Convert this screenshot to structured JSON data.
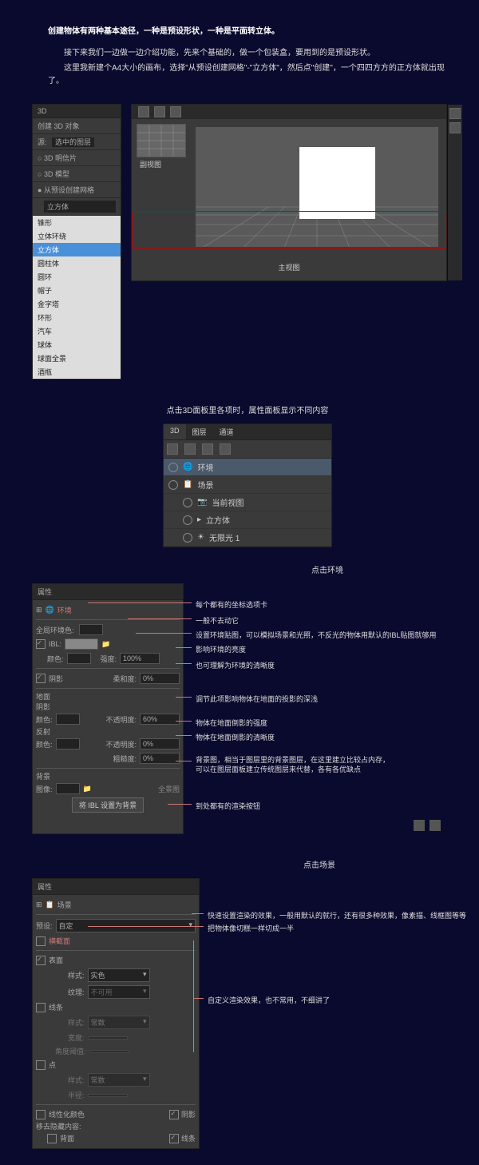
{
  "article": {
    "title": "创建物体有两种基本途径，一种是预设形状，一种是平面转立体。",
    "para1": "接下来我们一边做一边介绍功能，先来个基础的，做一个包装盒，要用到的是预设形状。",
    "para2": "这里我新建个A4大小的画布，选择\"从预设创建网格\"-\"立方体\"，然后点\"创建\"，一个四四方方的正方体就出现了。"
  },
  "leftpanel": {
    "header": "3D",
    "create_btn": "创建 3D 对象",
    "source_label": "源:",
    "source_value": "选中的图层",
    "opt_3d_postcard": "3D 明信片",
    "opt_3d_model": "3D 模型",
    "opt_preset_mesh": "从预设创建网格",
    "sel_cube": "立方体",
    "items": [
      "锥形",
      "立体环绕",
      "立方体",
      "圆柱体",
      "圆环",
      "帽子",
      "金字塔",
      "环形",
      "汽车",
      "球体",
      "球面全景",
      "酒瓶"
    ]
  },
  "viewport": {
    "top_label": "副视图",
    "main_label": "主视图"
  },
  "section2_title": "点击3D面板里各项时，属性面板显示不同内容",
  "panel3d": {
    "tabs": [
      "3D",
      "图层",
      "通道"
    ],
    "items": [
      "环境",
      "场景",
      "当前视图",
      "立方体",
      "无限光 1"
    ]
  },
  "section3_title": "点击环境",
  "env_panel": {
    "header": "属性",
    "title": "环境",
    "global_env_color": "全局环境色:",
    "ibl": "IBL:",
    "color": "颜色:",
    "intensity": "强度:",
    "intensity_val": "100%",
    "shadow": "阴影",
    "softness": "柔和度:",
    "softness_val": "0%",
    "ground": "地面",
    "ground_shadow": "阴影",
    "ground_color": "颜色:",
    "opacity": "不透明度:",
    "opacity_val": "60%",
    "reflection": "反射",
    "refl_color": "颜色:",
    "refl_opacity": "不透明度:",
    "refl_opacity_val": "0%",
    "roughness": "粗糙度:",
    "roughness_val": "0%",
    "background": "背景",
    "bg_image": "图像:",
    "bg_panorama": "全景图",
    "bg_btn": "将 IBL 设置为背景"
  },
  "env_annot": {
    "a1": "每个都有的坐标选项卡",
    "a2": "一般不去动它",
    "a3": "设置环境贴图，可以模拟场景和光照，不反光的物体用默认的IBL贴图就够用",
    "a4": "影响环境的亮度",
    "a5": "也可理解为环境的清晰度",
    "a6": "调节此项影响物体在地面的投影的深浅",
    "a7": "物体在地面倒影的强度",
    "a8": "物体在地面倒影的清晰度",
    "a9": "背景图，相当于图层里的背景图层，在这里建立比较占内存，",
    "a9b": "可以在图层面板建立传统图层来代替，各有各优缺点",
    "a10": "到处都有的渲染按钮"
  },
  "section4_title": "点击场景",
  "scene_panel": {
    "header": "属性",
    "title": "场景",
    "preset": "预设:",
    "preset_val": "自定",
    "cross_section": "横截面",
    "surface": "表面",
    "style": "样式:",
    "style_val": "实色",
    "texture": "纹理:",
    "texture_val": "不可用",
    "lines": "线条",
    "lines_style_val": "常数",
    "width": "宽度:",
    "angle_threshold": "角度阈值:",
    "points": "点",
    "points_style_val": "常数",
    "radius": "半径:",
    "linearize_color": "线性化颜色",
    "shadow_chk": "阴影",
    "move_hidden": "移去隐藏内容:",
    "backface": "背面",
    "lines_chk": "线条"
  },
  "scene_annot": {
    "a1": "快速设置渲染的效果，一般用默认的就行，还有很多种效果，像素描、线框图等等",
    "a2": "把物体像切糕一样切成一半",
    "a3": "自定义渲染效果，也不常用，不细讲了"
  }
}
